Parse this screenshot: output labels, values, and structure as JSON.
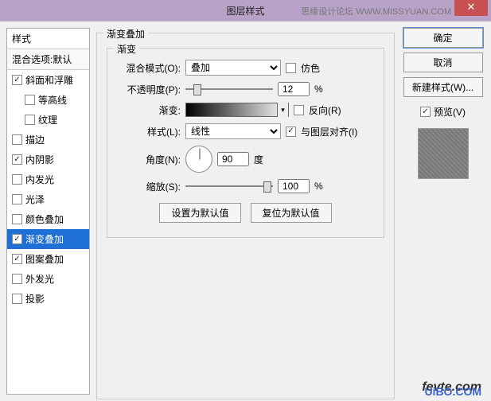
{
  "titlebar": {
    "title": "图层样式",
    "site": "思缘设计论坛 WWW.MISSYUAN.COM",
    "close": "✕"
  },
  "left": {
    "header": "样式",
    "sub": "混合选项:默认",
    "items": [
      {
        "label": "斜面和浮雕",
        "checked": true,
        "indent": false
      },
      {
        "label": "等高线",
        "checked": false,
        "indent": true
      },
      {
        "label": "纹理",
        "checked": false,
        "indent": true
      },
      {
        "label": "描边",
        "checked": false,
        "indent": false
      },
      {
        "label": "内阴影",
        "checked": true,
        "indent": false
      },
      {
        "label": "内发光",
        "checked": false,
        "indent": false
      },
      {
        "label": "光泽",
        "checked": false,
        "indent": false
      },
      {
        "label": "颜色叠加",
        "checked": false,
        "indent": false
      },
      {
        "label": "渐变叠加",
        "checked": true,
        "indent": false,
        "selected": true
      },
      {
        "label": "图案叠加",
        "checked": true,
        "indent": false
      },
      {
        "label": "外发光",
        "checked": false,
        "indent": false
      },
      {
        "label": "投影",
        "checked": false,
        "indent": false
      }
    ]
  },
  "center": {
    "group_title": "渐变叠加",
    "inner_title": "渐变",
    "blend_label": "混合模式(O):",
    "blend_value": "叠加",
    "dither_label": "仿色",
    "dither_checked": false,
    "opacity_label": "不透明度(P):",
    "opacity_value": "12",
    "pct": "%",
    "gradient_label": "渐变:",
    "reverse_label": "反向(R)",
    "reverse_checked": false,
    "style_label": "样式(L):",
    "style_value": "线性",
    "align_label": "与图层对齐(I)",
    "align_checked": true,
    "angle_label": "角度(N):",
    "angle_value": "90",
    "angle_unit": "度",
    "scale_label": "缩放(S):",
    "scale_value": "100",
    "reset_btn": "设置为默认值",
    "restore_btn": "复位为默认值"
  },
  "right": {
    "ok": "确定",
    "cancel": "取消",
    "newstyle": "新建样式(W)...",
    "preview_label": "预览(V)",
    "preview_checked": true
  },
  "watermark": {
    "line1": "fevte.com",
    "line2": "UiBO.COM"
  }
}
